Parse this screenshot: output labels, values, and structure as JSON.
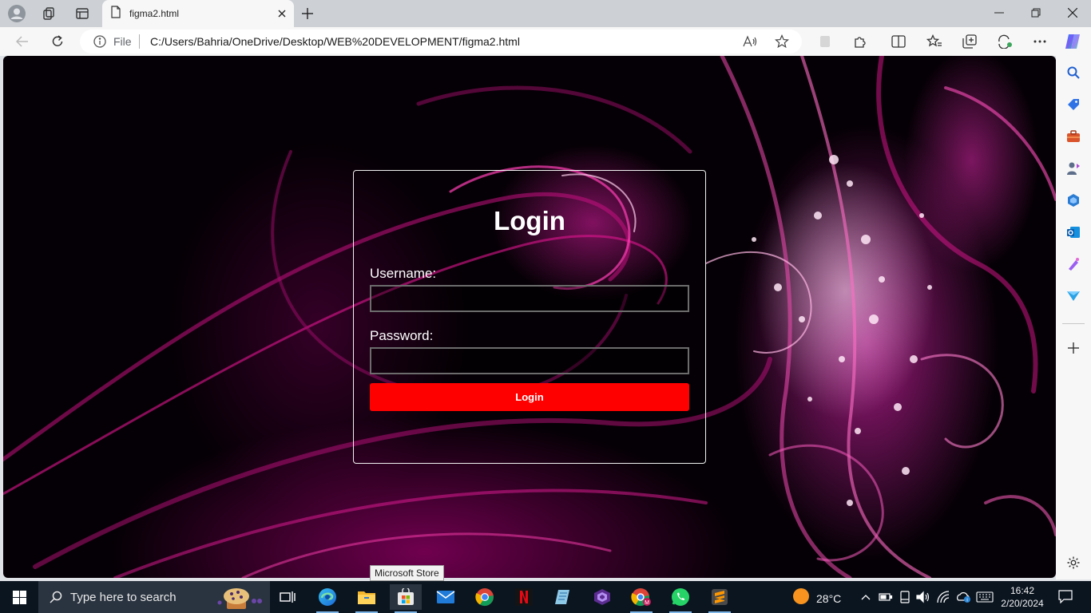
{
  "browser": {
    "tab_title": "figma2.html",
    "address_scheme": "File",
    "address_url": "C:/Users/Bahria/OneDrive/Desktop/WEB%20DEVELOPMENT/figma2.html"
  },
  "page": {
    "login_title": "Login",
    "username_label": "Username:",
    "username_value": "",
    "password_label": "Password:",
    "password_value": "",
    "login_button": "Login"
  },
  "tooltip": "Microsoft Store",
  "taskbar": {
    "search_placeholder": "Type here to search",
    "temperature": "28°C",
    "time": "16:42",
    "date": "2/20/2024",
    "pinned_apps": [
      "task-view",
      "microsoft-edge",
      "file-explorer",
      "microsoft-store",
      "mail",
      "google-chrome",
      "netflix",
      "notepad",
      "visual-studio",
      "chrome-profile",
      "whatsapp",
      "sublime-text"
    ]
  },
  "colors": {
    "accent_button": "#ff0000",
    "page_background": "#050005",
    "swirl_magenta": "#e0158f",
    "taskbar": "#0b1520"
  }
}
